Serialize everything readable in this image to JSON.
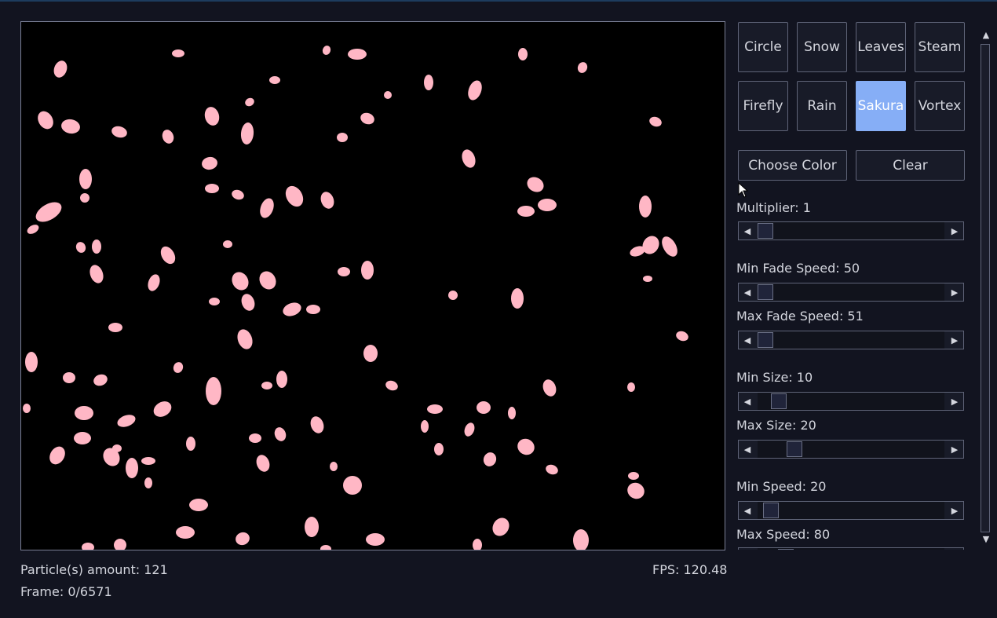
{
  "canvas": {
    "background": "#000000",
    "particle_color": "#ffb7c5",
    "particle_count_visible": 121
  },
  "status": {
    "particles": "Particle(s) amount: 121",
    "frame": "Frame: 0/6571",
    "fps": "FPS: 120.48"
  },
  "presets": [
    {
      "label": "Circle",
      "active": false
    },
    {
      "label": "Snow",
      "active": false
    },
    {
      "label": "Leaves",
      "active": false
    },
    {
      "label": "Steam",
      "active": false
    },
    {
      "label": "Firefly",
      "active": false
    },
    {
      "label": "Rain",
      "active": false
    },
    {
      "label": "Sakura",
      "active": true
    },
    {
      "label": "Vortex",
      "active": false
    }
  ],
  "actions": {
    "choose_color": "Choose Color",
    "clear": "Clear"
  },
  "controls": [
    {
      "label": "Multiplier: 1",
      "value_fraction": 0.0
    },
    {
      "label": "Min Fade Speed: 50",
      "value_fraction": 0.0
    },
    {
      "label": "Max Fade Speed: 51",
      "value_fraction": 0.0
    },
    {
      "label": "Min Size: 10",
      "value_fraction": 0.08
    },
    {
      "label": "Max Size: 20",
      "value_fraction": 0.17
    },
    {
      "label": "Min Speed: 20",
      "value_fraction": 0.03
    },
    {
      "label": "Max Speed: 80",
      "value_fraction": 0.12
    }
  ],
  "icons": {
    "slider_left": "◀",
    "slider_right": "▶",
    "scroll_up": "▲",
    "scroll_down": "▼",
    "cursor": "arrow-cursor"
  },
  "colors": {
    "accent": "#86aef6",
    "background": "#121420",
    "border": "#5f6478"
  }
}
